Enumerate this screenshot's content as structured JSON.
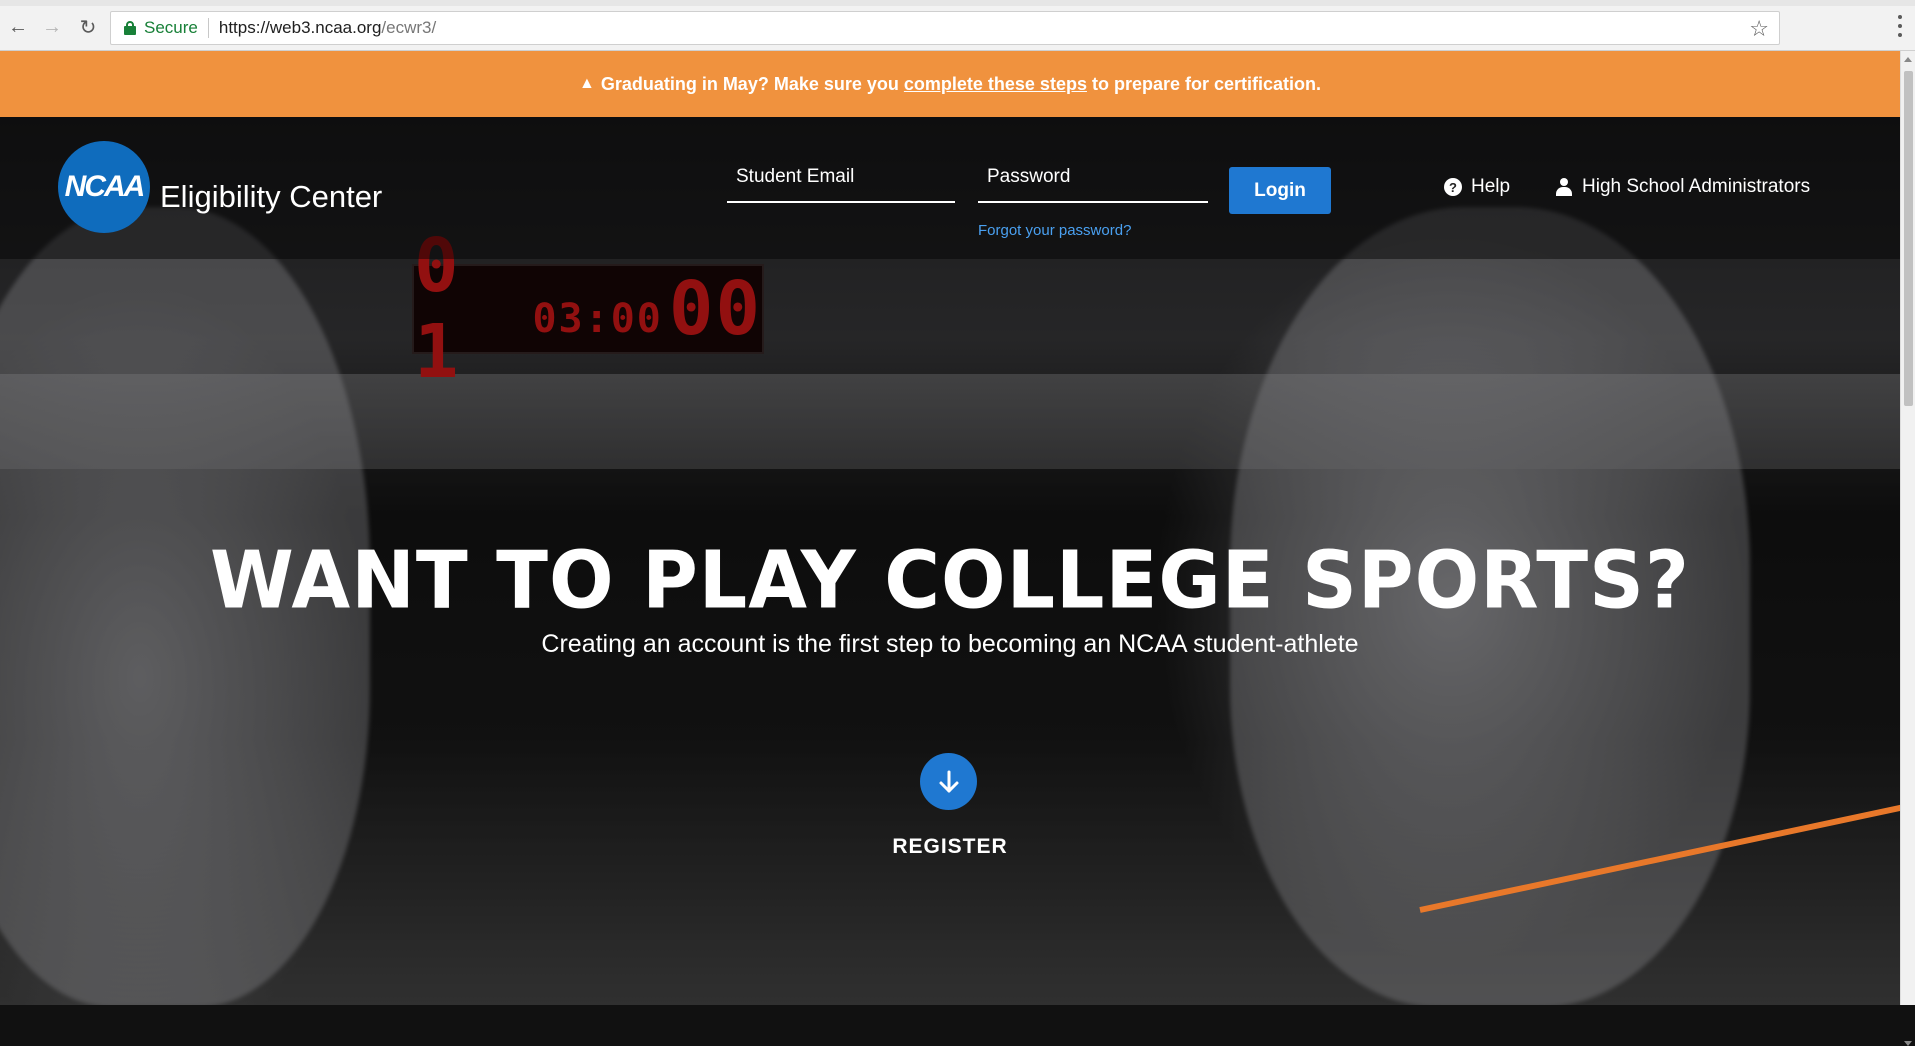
{
  "browser": {
    "secure_label": "Secure",
    "url_host": "https://web3.ncaa.org",
    "url_path": "/ecwr3/"
  },
  "banner": {
    "text_before": "Graduating in May? Make sure you",
    "link_text": "complete these steps",
    "text_after": "to prepare for certification.",
    "color": "#f0923e"
  },
  "header": {
    "logo_text": "NCAA",
    "brand": "Eligibility Center",
    "email_placeholder": "Student Email",
    "password_placeholder": "Password",
    "forgot_link": "Forgot your password?",
    "login_label": "Login",
    "help_label": "Help",
    "admin_label": "High School Administrators"
  },
  "hero": {
    "clock_left": "0 1",
    "clock_mid": "03:00",
    "clock_right": "00",
    "headline": "WANT TO PLAY COLLEGE SPORTS?",
    "subline": "Creating an account is the first step to becoming an NCAA student-athlete",
    "register_label": "REGISTER"
  },
  "colors": {
    "accent_blue": "#1f78d1",
    "link_blue": "#4aa0f0",
    "orange": "#f0923e"
  }
}
